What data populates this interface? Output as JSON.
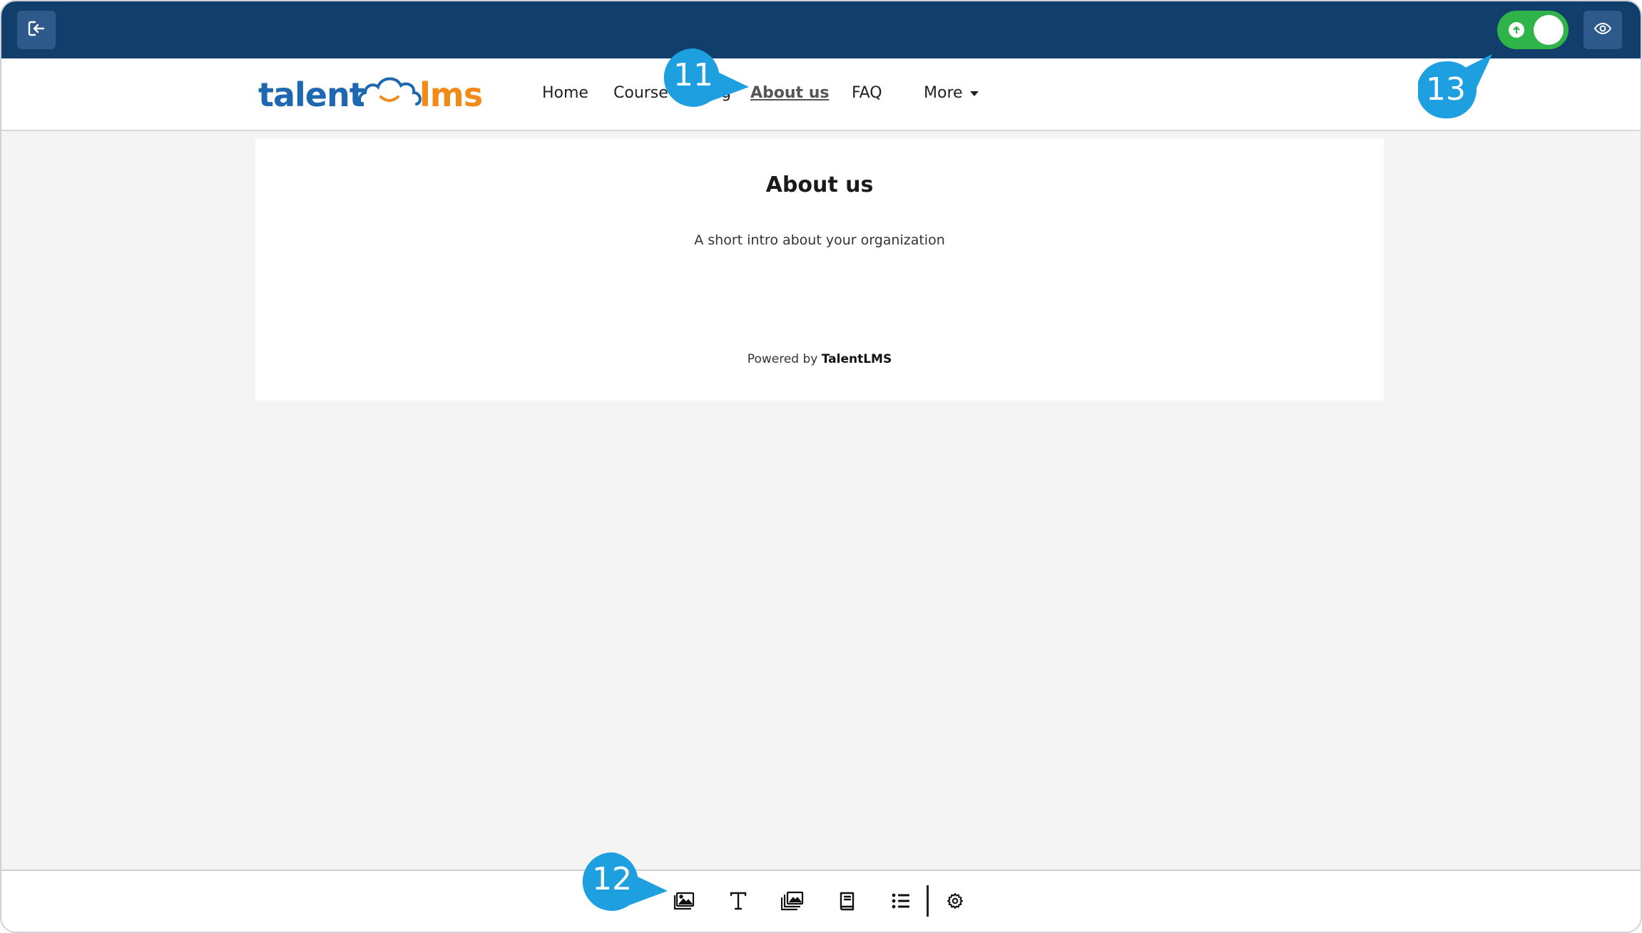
{
  "top_bar": {
    "exit_icon": "exit-icon",
    "publish_toggle_state": "on",
    "preview_icon": "eye-icon",
    "accent_color": "#113e6b",
    "toggle_color": "#2fb44a"
  },
  "header": {
    "logo_left": "talent",
    "logo_right": "lms",
    "nav": [
      {
        "label": "Home"
      },
      {
        "label": "Course catalog"
      },
      {
        "label": "About us"
      },
      {
        "label": "FAQ"
      },
      {
        "label": "More"
      }
    ]
  },
  "page": {
    "title": "About us",
    "intro": "A short intro about your organization",
    "powered_prefix": "Powered by",
    "powered_brand": "TalentLMS"
  },
  "toolbar": {
    "items": [
      "image-icon",
      "text-icon",
      "gallery-icon",
      "book-icon",
      "list-icon",
      "settings-icon"
    ]
  },
  "callouts": [
    "11",
    "12",
    "13"
  ]
}
